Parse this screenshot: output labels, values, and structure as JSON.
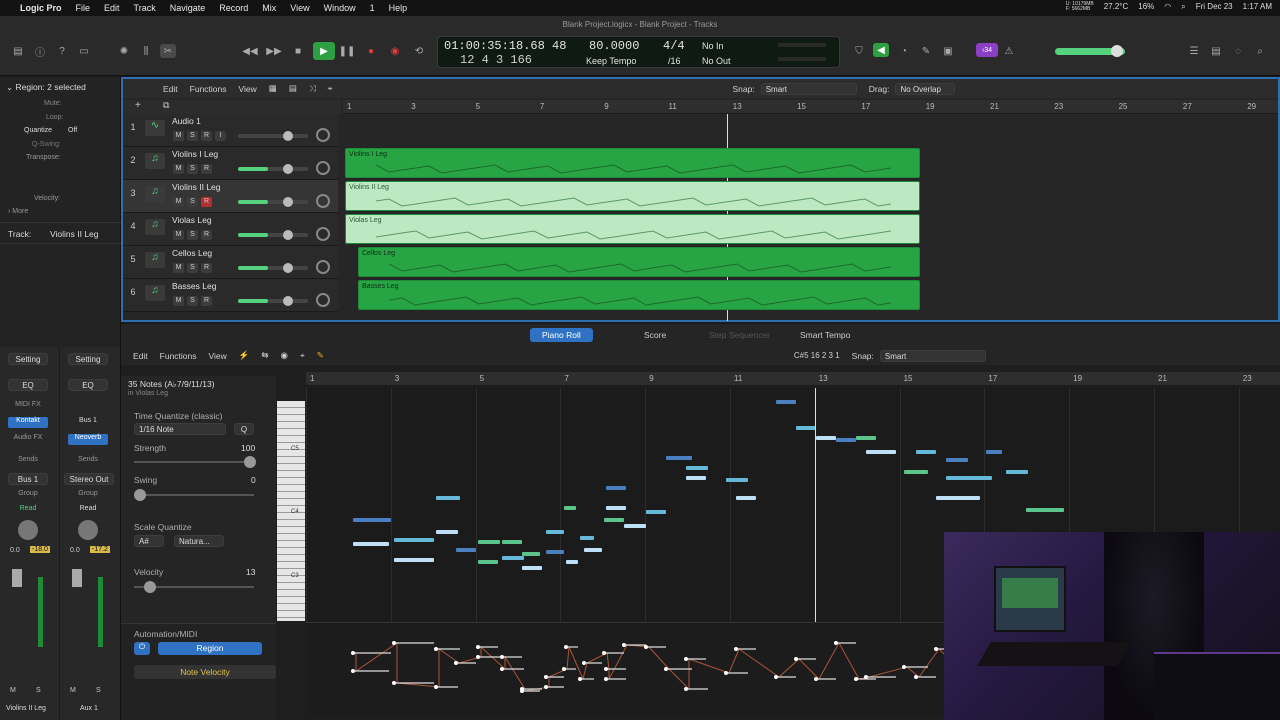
{
  "menubar": {
    "app": "Logic Pro",
    "items": [
      "File",
      "Edit",
      "Track",
      "Navigate",
      "Record",
      "Mix",
      "View",
      "Window",
      "1",
      "Help"
    ],
    "status": {
      "mem": "U: 10179MB\nF: 5662MB",
      "temp": "27.2°C",
      "cpu": "16%",
      "date": "Fri Dec 23",
      "time": "1:17 AM"
    }
  },
  "window": {
    "title": "Blank Project.logicx - Blank Project - Tracks"
  },
  "lcd": {
    "time": "01:00:35:18.68",
    "bars": "12  4  3  166",
    "bar": "48",
    "tempo": "80.0000",
    "tempo_mode": "Keep Tempo",
    "sig": "4/4",
    "div": "/16",
    "in": "No In",
    "out": "No Out"
  },
  "toolbar": {
    "badge": "‹34"
  },
  "inspector": {
    "region_header": "Region: 2 selected",
    "mute": "Mute:",
    "loop": "Loop:",
    "quantize": "Quantize",
    "quantize_val": "Off",
    "qswing": "Q-Swing:",
    "transpose": "Transpose:",
    "velocity": "Velocity:",
    "more": "More",
    "track_header": "Track:",
    "track_name": "Violins II Leg",
    "strips": [
      {
        "setting": "Setting",
        "eq": "EQ",
        "midifx": "MIDI FX",
        "inst": "Kontakt",
        "audiofx": "Audio FX",
        "sends": "Sends",
        "io": "Bus 1",
        "group": "Group",
        "auto": "Read",
        "pan": "0.0",
        "db": "-18.0",
        "name": "Violins II Leg"
      },
      {
        "setting": "Setting",
        "eq": "EQ",
        "midifx": "",
        "inst": "Bus 1",
        "audiofx": "Neoverb",
        "sends": "Sends",
        "io": "Stereo Out",
        "group": "Group",
        "auto": "Read",
        "pan": "0.0",
        "db": "-17.2",
        "name": "Aux 1"
      }
    ]
  },
  "tracks_header": {
    "edit": "Edit",
    "functions": "Functions",
    "view": "View",
    "snap_label": "Snap:",
    "snap": "Smart",
    "drag_label": "Drag:",
    "drag": "No Overlap"
  },
  "ruler": [
    "1",
    "3",
    "5",
    "7",
    "9",
    "11",
    "13",
    "15",
    "17",
    "19",
    "21",
    "23",
    "25",
    "27",
    "29"
  ],
  "tracks": [
    {
      "num": "1",
      "name": "Audio 1",
      "icon": "waveform-icon"
    },
    {
      "num": "2",
      "name": "Violins I Leg",
      "icon": "music-note-icon"
    },
    {
      "num": "3",
      "name": "Violins II Leg",
      "icon": "music-note-icon"
    },
    {
      "num": "4",
      "name": "Violas Leg",
      "icon": "music-note-icon"
    },
    {
      "num": "5",
      "name": "Cellos Leg",
      "icon": "music-note-icon"
    },
    {
      "num": "6",
      "name": "Basses Leg",
      "icon": "music-note-icon"
    }
  ],
  "regions": [
    {
      "name": "Violins I Leg",
      "row": 1,
      "sel": false
    },
    {
      "name": "Violins II Leg",
      "row": 2,
      "sel": true
    },
    {
      "name": "Violas Leg",
      "row": 3,
      "sel": true
    },
    {
      "name": "Cellos Leg",
      "row": 4,
      "sel": false
    },
    {
      "name": "Basses Leg",
      "row": 5,
      "sel": false
    }
  ],
  "tabs": [
    "Piano Roll",
    "Score",
    "Step Sequencer",
    "Smart Tempo"
  ],
  "piano": {
    "edit": "Edit",
    "functions": "Functions",
    "view": "View",
    "pos": "C#5  16 2 3 1",
    "snap_label": "Snap:",
    "snap": "Smart",
    "notes_count": "35 Notes (A♭7/9/11/13)",
    "in_region": "in Violas Leg",
    "tq_label": "Time Quantize (classic)",
    "tq_val": "1/16 Note",
    "q": "Q",
    "strength_label": "Strength",
    "strength": "100",
    "swing_label": "Swing",
    "swing": "0",
    "sq_label": "Scale Quantize",
    "sq_key": "A#",
    "sq_scale": "Natura...",
    "velocity_label": "Velocity",
    "velocity": "13",
    "auto_label": "Automation/MIDI",
    "region_btn": "Region",
    "note_vel": "Note Velocity",
    "ruler": [
      "1",
      "3",
      "5",
      "7",
      "9",
      "11",
      "13",
      "15",
      "17",
      "19",
      "21",
      "23"
    ],
    "keys": [
      "C5",
      "C4",
      "C3"
    ]
  }
}
